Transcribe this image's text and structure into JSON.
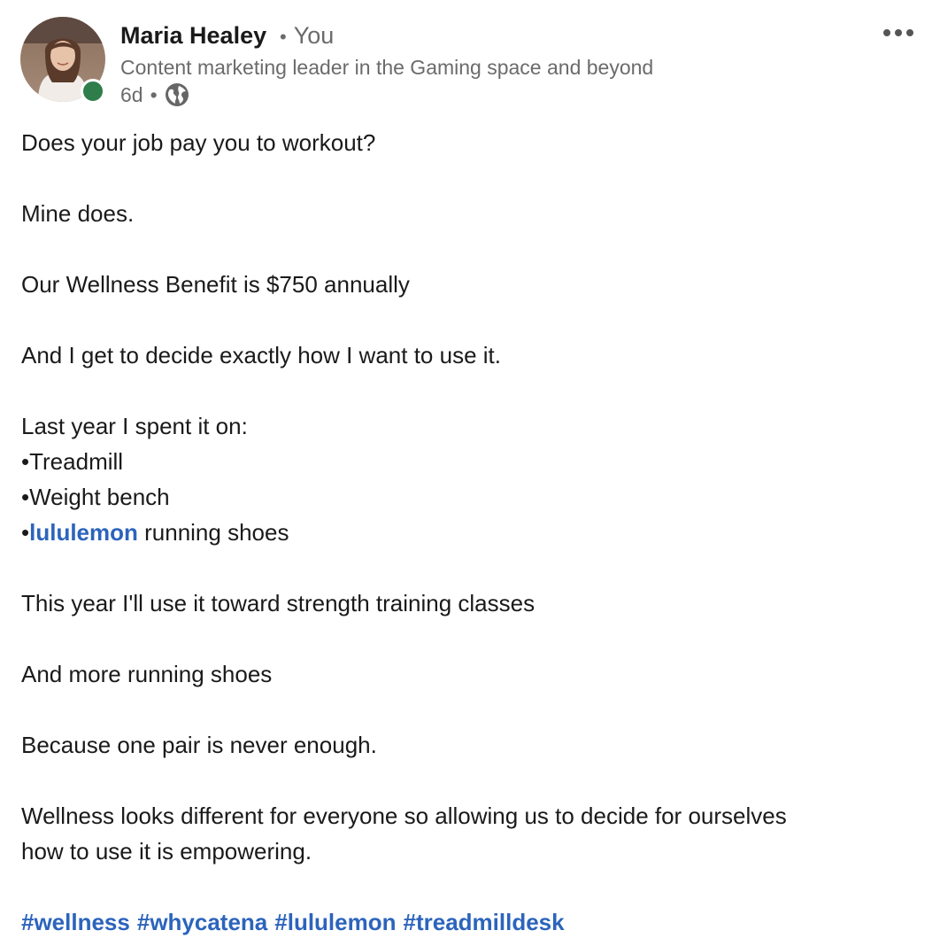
{
  "author": {
    "name": "Maria Healey",
    "connection_degree": "You",
    "headline": "Content marketing leader in the Gaming space and beyond",
    "posted_ago": "6d",
    "visibility_icon": "globe-icon",
    "online_status_color": "#2f7d4a"
  },
  "post": {
    "lines": {
      "l1": "Does your job pay you to workout?",
      "l2": "Mine does.",
      "l3": "Our Wellness Benefit is $750 annually",
      "l4": "And I get to decide exactly how I want to use it.",
      "l5": "Last year I spent it on:",
      "b1": "Treadmill",
      "b2": "Weight bench",
      "b3_mention": "lululemon",
      "b3_rest": " running shoes",
      "l6": "This year I'll use it toward strength training classes",
      "l7": "And more running shoes",
      "l8": "Because one pair is never enough.",
      "l9a": "Wellness looks different for everyone so allowing us to decide for ourselves",
      "l9b": "how to use it is empowering."
    },
    "bullet_char": "•",
    "hashtags": [
      "#wellness",
      "#whycatena",
      "#lululemon",
      "#treadmilldesk"
    ]
  },
  "colors": {
    "link": "#2c64bc",
    "text": "#1a1a1a",
    "muted": "#6b6b6b"
  }
}
